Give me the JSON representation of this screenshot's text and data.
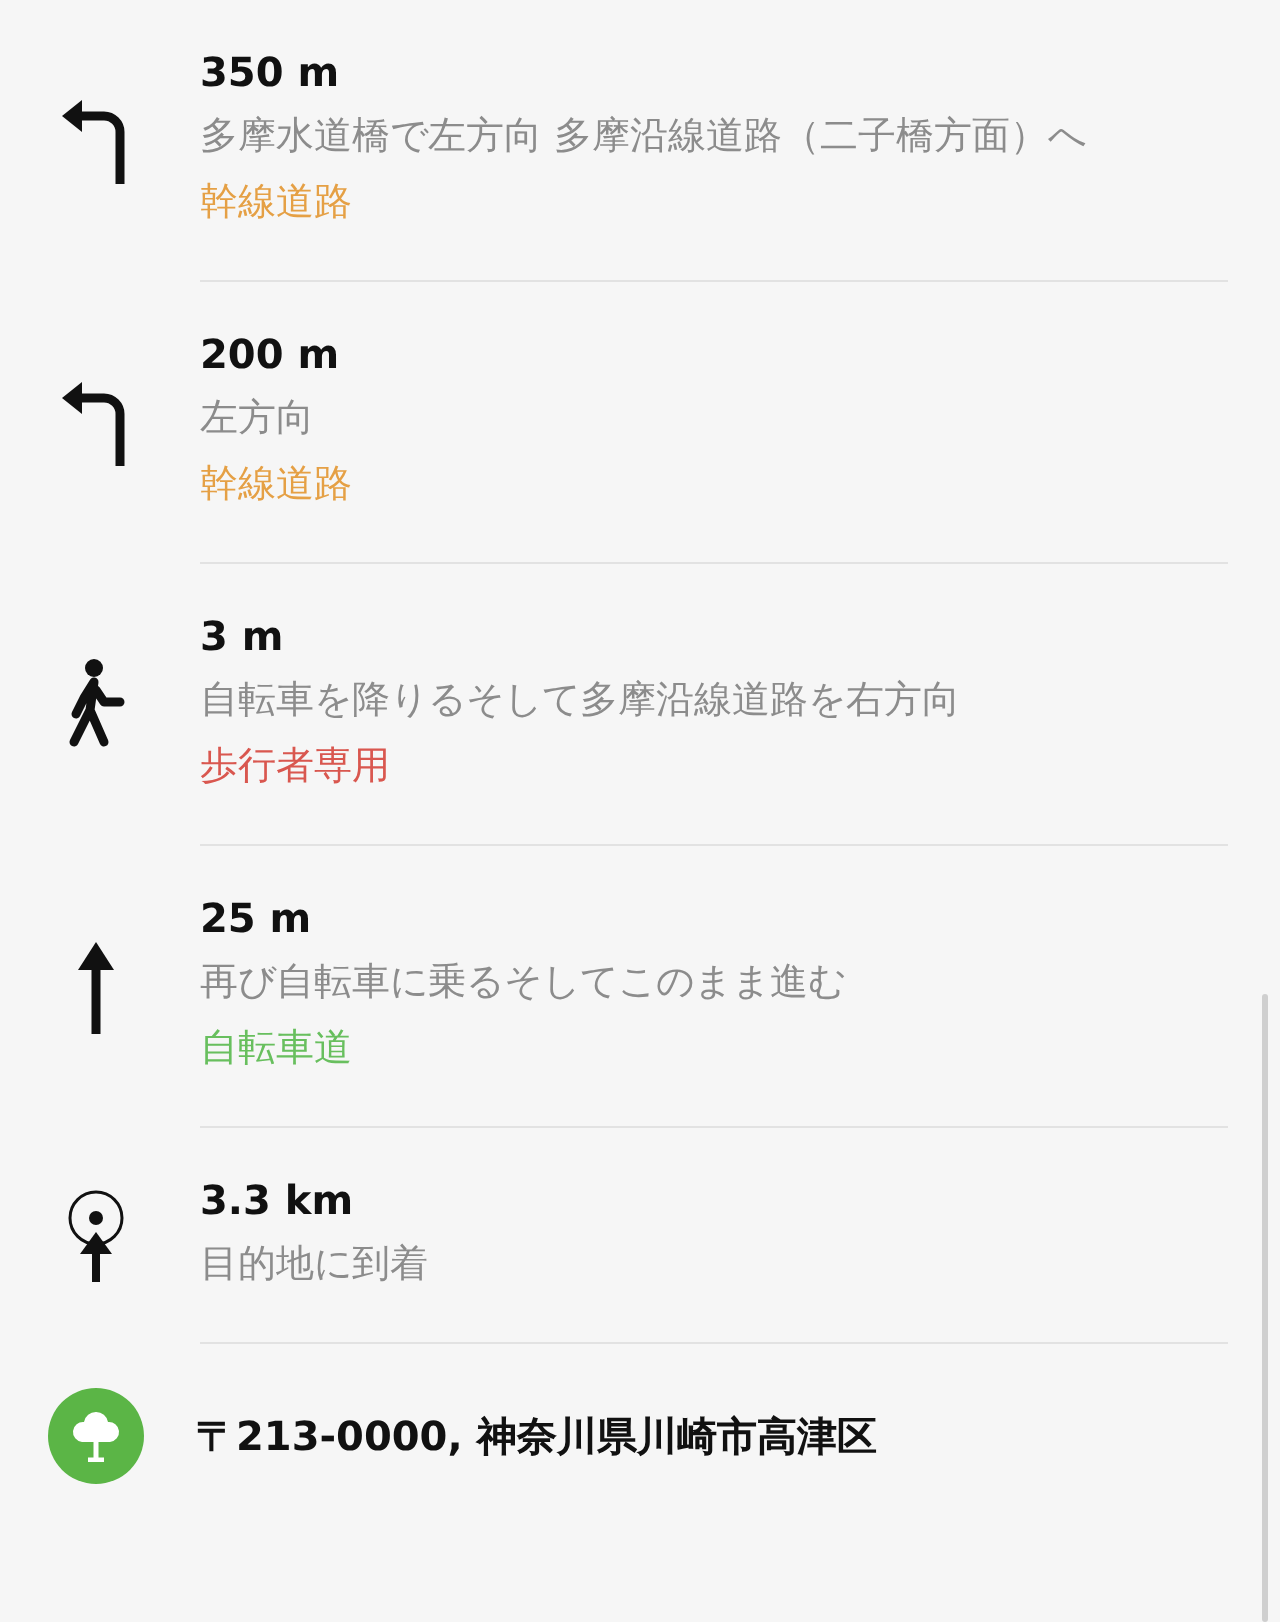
{
  "steps": [
    {
      "kind": "left",
      "distance": "350 m",
      "instruction": "多摩水道橋で左方向 多摩沿線道路（二子橋方面）へ",
      "road": "幹線道路",
      "color": "#e5a045"
    },
    {
      "kind": "left",
      "distance": "200 m",
      "instruction": "左方向",
      "road": "幹線道路",
      "color": "#e5a045"
    },
    {
      "kind": "walk",
      "distance": "3 m",
      "instruction": "自転車を降りるそして多摩沿線道路を右方向",
      "road": "歩行者専用",
      "color": "#d9574f"
    },
    {
      "kind": "straight",
      "distance": "25 m",
      "instruction": "再び自転車に乗るそしてこのまま進む",
      "road": "自転車道",
      "color": "#68bf5e"
    },
    {
      "kind": "arrive",
      "distance": "3.3 km",
      "instruction": "目的地に到着"
    }
  ],
  "destination": {
    "address": "〒213-0000, 神奈川県川崎市高津区"
  }
}
